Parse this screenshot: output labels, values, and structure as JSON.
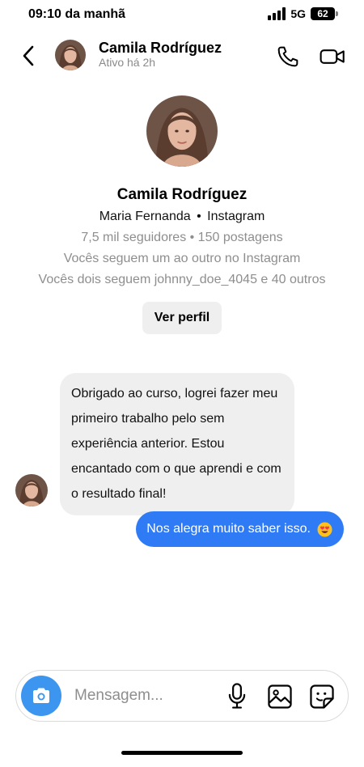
{
  "status_bar": {
    "time": "09:10 da manhã",
    "network": "5G",
    "battery": "62"
  },
  "header": {
    "name": "Camila Rodríguez",
    "status": "Ativo há 2h",
    "back_icon": "chevron-left-icon",
    "call_icon": "phone-icon",
    "video_icon": "video-camera-icon"
  },
  "profile": {
    "name": "Camila Rodríguez",
    "username": "Maria Fernanda",
    "platform": "Instagram",
    "stats": "7,5 mil seguidores • 150 postagens",
    "follow_status": "Vocês seguem um ao outro no Instagram",
    "mutuals": "Vocês dois seguem johnny_doe_4045 e 40 outros",
    "view_button": "Ver perfil"
  },
  "messages": [
    {
      "direction": "incoming",
      "text": "Obrigado ao curso, logrei fazer meu primeiro trabalho pelo sem experiência anterior. Estou encantado com o que aprendi e com o resultado final!"
    },
    {
      "direction": "outgoing",
      "text": "Nos alegra muito saber isso.",
      "emoji": "smiling-face-with-heart-eyes"
    }
  ],
  "composer": {
    "placeholder": "Mensagem...",
    "camera_icon": "camera-icon",
    "mic_icon": "microphone-icon",
    "gallery_icon": "image-icon",
    "sticker_icon": "sticker-icon"
  },
  "colors": {
    "outgoing_bubble": "#2f7bf5",
    "incoming_bubble": "#efefef",
    "camera_button": "#3c95ef",
    "muted_text": "#8e8e8e"
  }
}
